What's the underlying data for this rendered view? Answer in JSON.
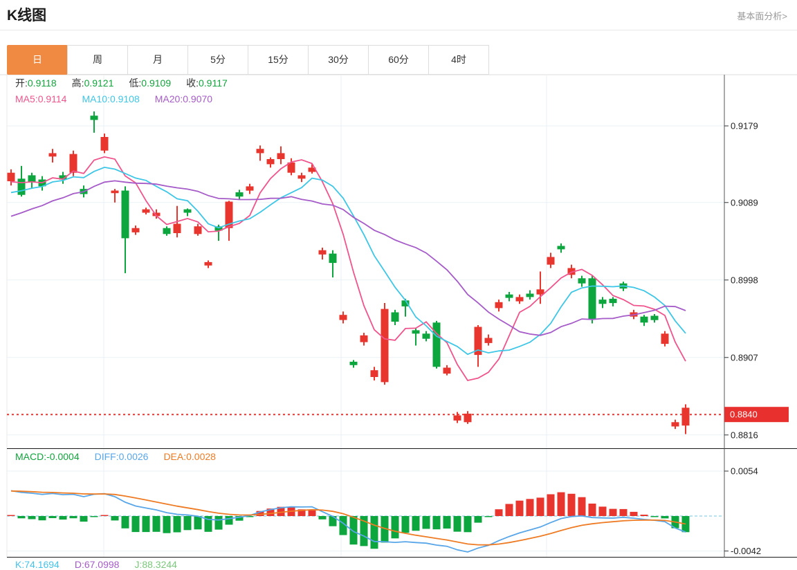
{
  "header": {
    "title": "K线图",
    "analysis_link": "基本面分析>"
  },
  "tabs": {
    "items": [
      "日",
      "周",
      "月",
      "5分",
      "15分",
      "30分",
      "60分",
      "4时"
    ],
    "names": [
      "day",
      "week",
      "month",
      "5min",
      "15min",
      "30min",
      "60min",
      "4hour"
    ],
    "active_index": 0,
    "active_color": "#f08a42"
  },
  "price_panel": {
    "ohlc_legend": [
      {
        "label": "开:",
        "value": "0.9118"
      },
      {
        "label": "高:",
        "value": "0.9121"
      },
      {
        "label": "低:",
        "value": "0.9109"
      },
      {
        "label": "收:",
        "value": "0.9117"
      }
    ],
    "ohlc_value_color": "#11a43c",
    "ma_legend": [
      {
        "label": "MA5:",
        "value": "0.9114",
        "color": "#f0548c"
      },
      {
        "label": "MA10:",
        "value": "0.9108",
        "color": "#3ec6e6"
      },
      {
        "label": "MA20:",
        "value": "0.9070",
        "color": "#a55bc8"
      }
    ]
  },
  "macd_panel": {
    "legend": [
      {
        "label": "MACD:",
        "value": "-0.0004",
        "color": "#11a43c"
      },
      {
        "label": "DIFF:",
        "value": "0.0026",
        "color": "#58a6e8"
      },
      {
        "label": "DEA:",
        "value": "0.0028",
        "color": "#ee7b23"
      }
    ]
  },
  "kdj_panel": {
    "legend": [
      {
        "label": "K:",
        "value": "74.1694",
        "color": "#45c2e8"
      },
      {
        "label": "D:",
        "value": "67.0998",
        "color": "#a55bc8"
      },
      {
        "label": "J:",
        "value": "88.3244",
        "color": "#7cc87c"
      }
    ]
  },
  "chart_data": {
    "type": "candlestick",
    "title": "K线图 daily candles with MA5/MA10/MA20 overlay and MACD sub-panel",
    "up_color": "#e8352e",
    "down_color": "#0ca53e",
    "grid": true,
    "price_axis": {
      "ticks": [
        0.9179,
        0.9089,
        0.8998,
        0.8907,
        0.8816
      ],
      "tick_labels": [
        "0.9179",
        "0.9089",
        "0.8998",
        "0.8907",
        "0.8816"
      ]
    },
    "current_price": {
      "value": 0.884,
      "label": "0.8840",
      "line_color": "#e8352e",
      "badge_color": "#e8302e"
    },
    "ma_windows": [
      5,
      10,
      20
    ],
    "ma_colors": [
      "#f0548c",
      "#3ec6e6",
      "#a55bc8"
    ],
    "candles": [
      [
        0.9114,
        0.9128,
        0.9109,
        0.9124
      ],
      [
        0.9117,
        0.9132,
        0.9096,
        0.9098
      ],
      [
        0.9121,
        0.9124,
        0.9105,
        0.9113
      ],
      [
        0.9116,
        0.912,
        0.9103,
        0.9108
      ],
      [
        0.9143,
        0.9152,
        0.9136,
        0.9147
      ],
      [
        0.9121,
        0.9125,
        0.9111,
        0.9116
      ],
      [
        0.9124,
        0.915,
        0.912,
        0.9146
      ],
      [
        0.9105,
        0.9109,
        0.9095,
        0.9099
      ],
      [
        0.9191,
        0.9196,
        0.9171,
        0.9186
      ],
      [
        0.915,
        0.917,
        0.9147,
        0.9166
      ],
      [
        0.91,
        0.9105,
        0.9089,
        0.9103
      ],
      [
        0.9103,
        0.9108,
        0.9006,
        0.9047
      ],
      [
        0.9054,
        0.9062,
        0.9051,
        0.9059
      ],
      [
        0.9077,
        0.9083,
        0.9075,
        0.9081
      ],
      [
        0.9073,
        0.9081,
        0.907,
        0.9077
      ],
      [
        0.9059,
        0.9061,
        0.905,
        0.9052
      ],
      [
        0.9053,
        0.9085,
        0.9048,
        0.9064
      ],
      [
        0.9081,
        0.9082,
        0.9073,
        0.9077
      ],
      [
        0.9052,
        0.9064,
        0.905,
        0.9061
      ],
      [
        0.9015,
        0.9021,
        0.9012,
        0.9019
      ],
      [
        0.9061,
        0.9063,
        0.9044,
        0.9056
      ],
      [
        0.9059,
        0.9091,
        0.9044,
        0.909
      ],
      [
        0.9101,
        0.9104,
        0.9092,
        0.9096
      ],
      [
        0.9103,
        0.9111,
        0.9099,
        0.9108
      ],
      [
        0.9147,
        0.9156,
        0.9138,
        0.9152
      ],
      [
        0.9134,
        0.9142,
        0.913,
        0.914
      ],
      [
        0.914,
        0.9155,
        0.9134,
        0.9147
      ],
      [
        0.9124,
        0.9141,
        0.9121,
        0.9136
      ],
      [
        0.9117,
        0.9124,
        0.9113,
        0.9121
      ],
      [
        0.9125,
        0.9134,
        0.9123,
        0.913
      ],
      [
        0.9028,
        0.9036,
        0.9022,
        0.9033
      ],
      [
        0.9029,
        0.9033,
        0.9001,
        0.9018
      ],
      [
        0.8951,
        0.8961,
        0.8947,
        0.8957
      ],
      [
        0.8902,
        0.8904,
        0.8895,
        0.8898
      ],
      [
        0.8925,
        0.8936,
        0.8921,
        0.8933
      ],
      [
        0.8884,
        0.8896,
        0.888,
        0.8892
      ],
      [
        0.8878,
        0.8971,
        0.8875,
        0.8964
      ],
      [
        0.896,
        0.8963,
        0.8945,
        0.8949
      ],
      [
        0.8974,
        0.8976,
        0.8955,
        0.8967
      ],
      [
        0.8939,
        0.8942,
        0.8921,
        0.8935
      ],
      [
        0.8935,
        0.8938,
        0.8926,
        0.8929
      ],
      [
        0.8948,
        0.895,
        0.8894,
        0.8896
      ],
      [
        0.8888,
        0.8898,
        0.8886,
        0.8895
      ],
      [
        0.8833,
        0.8843,
        0.883,
        0.8839
      ],
      [
        0.8831,
        0.8844,
        0.8829,
        0.8841
      ],
      [
        0.891,
        0.8945,
        0.8896,
        0.8943
      ],
      [
        0.8924,
        0.8934,
        0.8921,
        0.893
      ],
      [
        0.8965,
        0.8975,
        0.8961,
        0.8972
      ],
      [
        0.8981,
        0.8984,
        0.8973,
        0.8977
      ],
      [
        0.8973,
        0.8981,
        0.897,
        0.8978
      ],
      [
        0.8982,
        0.8986,
        0.8975,
        0.8978
      ],
      [
        0.8981,
        0.9008,
        0.897,
        0.8987
      ],
      [
        0.9016,
        0.903,
        0.9012,
        0.9025
      ],
      [
        0.9038,
        0.9041,
        0.903,
        0.9034
      ],
      [
        0.9004,
        0.9016,
        0.9,
        0.9012
      ],
      [
        0.9,
        0.9003,
        0.899,
        0.8994
      ],
      [
        0.9,
        0.9003,
        0.8947,
        0.8952
      ],
      [
        0.8975,
        0.8978,
        0.8965,
        0.897
      ],
      [
        0.8976,
        0.8978,
        0.8967,
        0.8971
      ],
      [
        0.8994,
        0.8996,
        0.8985,
        0.8988
      ],
      [
        0.8955,
        0.8963,
        0.8952,
        0.896
      ],
      [
        0.8955,
        0.8957,
        0.8944,
        0.8948
      ],
      [
        0.8956,
        0.8958,
        0.8948,
        0.8951
      ],
      [
        0.8923,
        0.8938,
        0.892,
        0.8935
      ],
      [
        0.8826,
        0.8834,
        0.8823,
        0.8831
      ],
      [
        0.8827,
        0.8852,
        0.8817,
        0.8848
      ]
    ],
    "macd": {
      "legend_values": {
        "macd": -0.0004,
        "diff": 0.0026,
        "dea": 0.0028
      },
      "axis_ticks": [
        0.0054,
        -0.0042
      ],
      "axis_tick_labels": [
        "0.0054",
        "-0.0042"
      ],
      "diff_color": "#58a6e8",
      "dea_color": "#ee7b23",
      "zero_line_color": "#8fd0e8"
    }
  }
}
